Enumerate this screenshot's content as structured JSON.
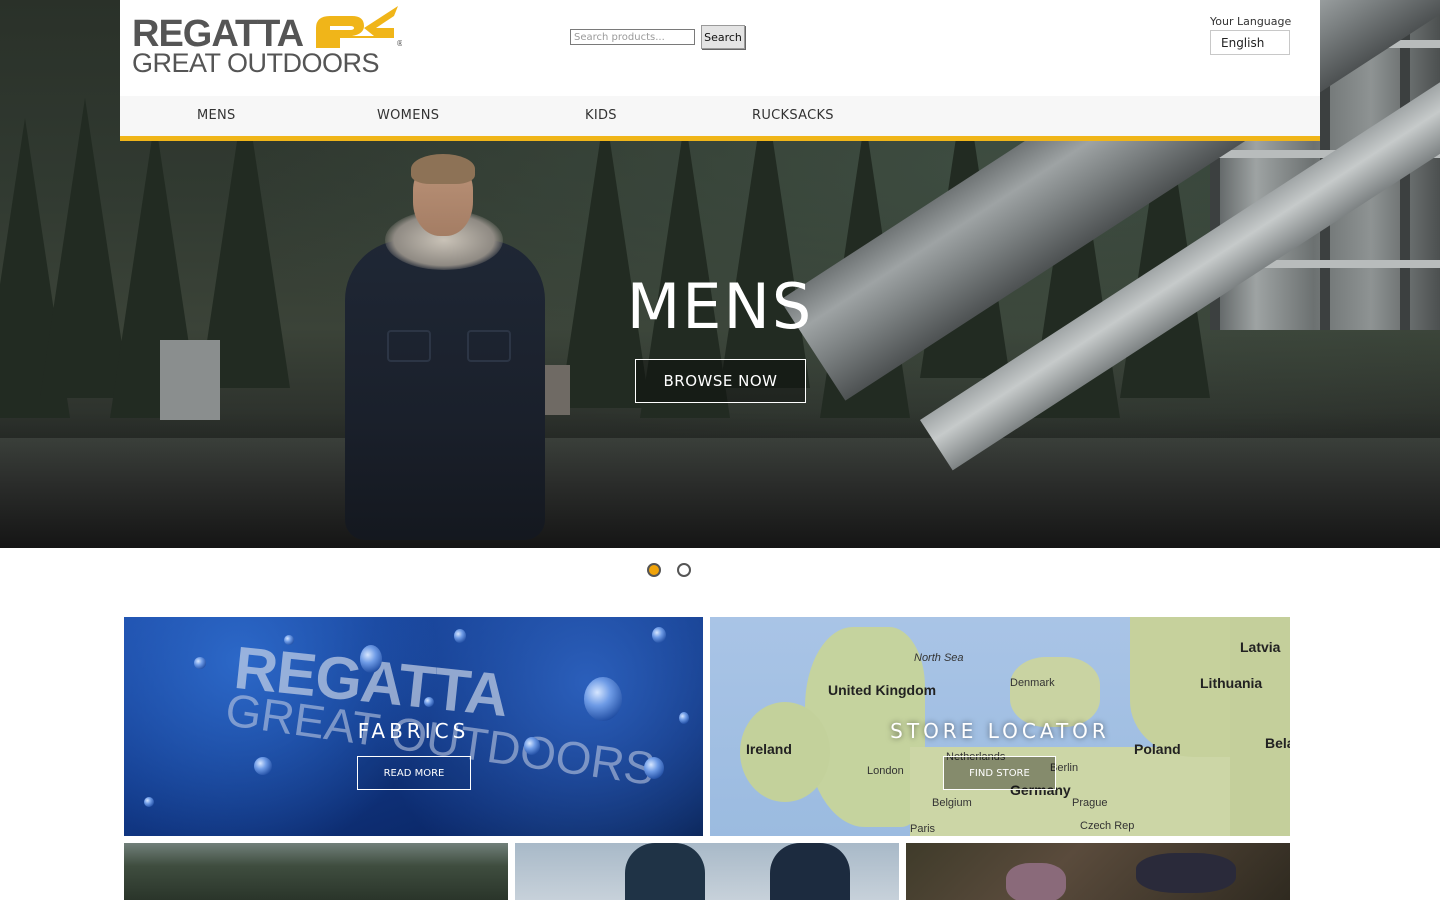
{
  "brand": {
    "logo_line1": "REGATTA",
    "logo_line2": "GREAT OUTDOORS",
    "logo_symbol": "regatta-r-icon",
    "accent_color": "#f0b519",
    "text_color": "#555555"
  },
  "header": {
    "search": {
      "placeholder": "Search products...",
      "value": "",
      "button_label": "Search"
    },
    "language": {
      "label": "Your Language",
      "selected": "English"
    }
  },
  "nav": {
    "items": [
      {
        "label": "MENS"
      },
      {
        "label": "WOMENS"
      },
      {
        "label": "KIDS"
      },
      {
        "label": "RUCKSACKS"
      }
    ]
  },
  "hero": {
    "title": "MENS",
    "button_label": "BROWSE NOW",
    "slides_count": 2,
    "active_slide": 1,
    "active_dot_color": "#f0a30a"
  },
  "tiles": [
    {
      "title": "FABRICS",
      "button_label": "READ MORE",
      "image_text_1": "REGATTA",
      "image_text_2": "GREAT OUTDOORS"
    },
    {
      "title": "STORE LOCATOR",
      "button_label": "FIND STORE"
    }
  ],
  "map_labels": {
    "north_sea": "North Sea",
    "uk": "United Kingdom",
    "ireland": "Ireland",
    "london": "London",
    "denmark": "Denmark",
    "latvia": "Latvia",
    "lithuania": "Lithuania",
    "poland": "Poland",
    "belarus": "Bela",
    "netherlands": "Netherlands",
    "berlin": "Berlin",
    "germany": "Germany",
    "belgium": "Belgium",
    "prague": "Prague",
    "czech": "Czech Rep",
    "paris": "Paris"
  }
}
